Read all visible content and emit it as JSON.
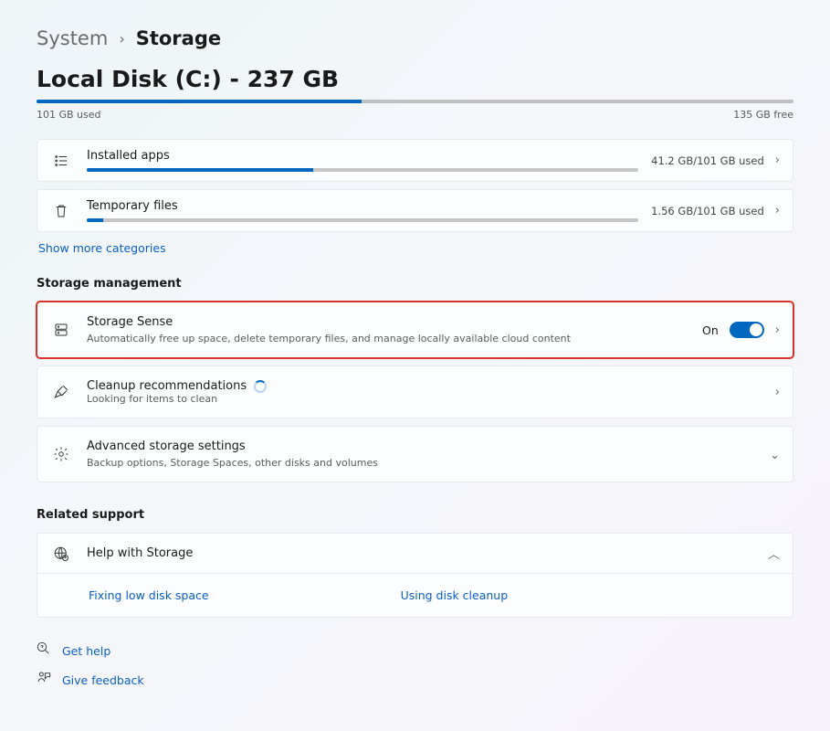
{
  "breadcrumb": {
    "parent": "System",
    "current": "Storage"
  },
  "disk": {
    "title": "Local Disk (C:) - 237 GB",
    "used_label": "101 GB used",
    "free_label": "135 GB free",
    "fill_pct": 43
  },
  "categories": {
    "installed": {
      "title": "Installed apps",
      "usage": "41.2 GB/101 GB used",
      "fill_pct": 41
    },
    "temp": {
      "title": "Temporary files",
      "usage": "1.56 GB/101 GB used",
      "fill_pct": 3
    },
    "show_more": "Show more categories"
  },
  "mgmt": {
    "header": "Storage management",
    "sense": {
      "title": "Storage Sense",
      "sub": "Automatically free up space, delete temporary files, and manage locally available cloud content",
      "state": "On"
    },
    "cleanup": {
      "title": "Cleanup recommendations",
      "sub": "Looking for items to clean"
    },
    "advanced": {
      "title": "Advanced storage settings",
      "sub": "Backup options, Storage Spaces, other disks and volumes"
    }
  },
  "support": {
    "header": "Related support",
    "help_title": "Help with Storage",
    "links": {
      "low_disk": "Fixing low disk space",
      "cleanup": "Using disk cleanup"
    }
  },
  "footer": {
    "get_help": "Get help",
    "feedback": "Give feedback"
  }
}
